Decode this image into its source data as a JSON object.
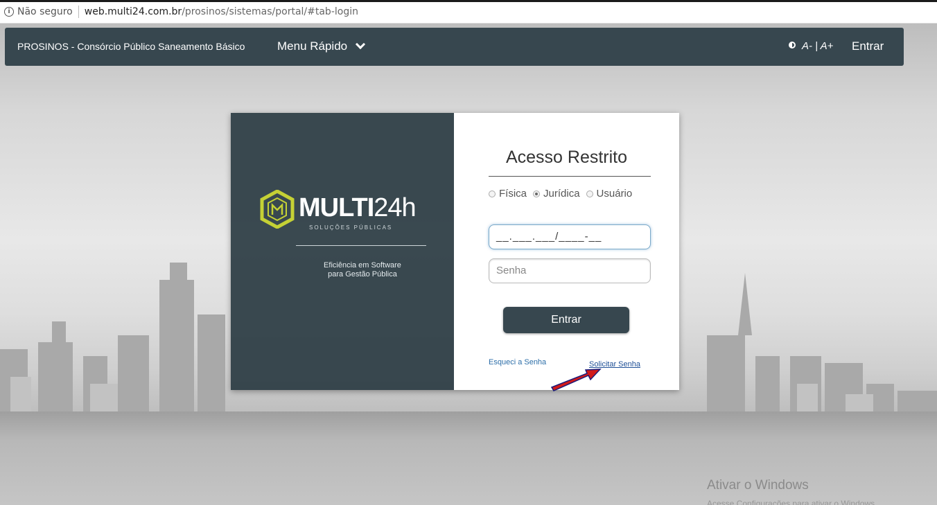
{
  "browser": {
    "security_label": "Não seguro",
    "url_host": "web.multi24.com.br",
    "url_path": "/prosinos/sistemas/portal/#tab-login"
  },
  "nav": {
    "brand": "PROSINOS - Consórcio Público Saneamento Básico",
    "menu_label": "Menu Rápido",
    "font_size_control": "A- | A+",
    "login_label": "Entrar"
  },
  "branding": {
    "logo_main": "MULTI",
    "logo_accent": "24h",
    "logo_sub": "SOLUÇÕES PÚBLICAS",
    "tagline_line1": "Eficiência em Software",
    "tagline_line2": "para Gestão Pública"
  },
  "login": {
    "title": "Acesso Restrito",
    "person_types": [
      {
        "label": "Física",
        "selected": false
      },
      {
        "label": "Jurídica",
        "selected": true
      },
      {
        "label": "Usuário",
        "selected": false
      }
    ],
    "document_value": "__.___.___/____-__",
    "password_placeholder": "Senha",
    "submit_label": "Entrar",
    "forgot_label": "Esqueci a Senha",
    "request_label": "Solicitar Senha"
  },
  "watermark": {
    "title": "Ativar o Windows",
    "subtitle": "Acesse Configurações para ativar o Windows."
  },
  "colors": {
    "nav_bg": "#37474f",
    "logo_accent": "#c5d135",
    "link": "#1e4f96",
    "arrow": "#d11a1a"
  }
}
